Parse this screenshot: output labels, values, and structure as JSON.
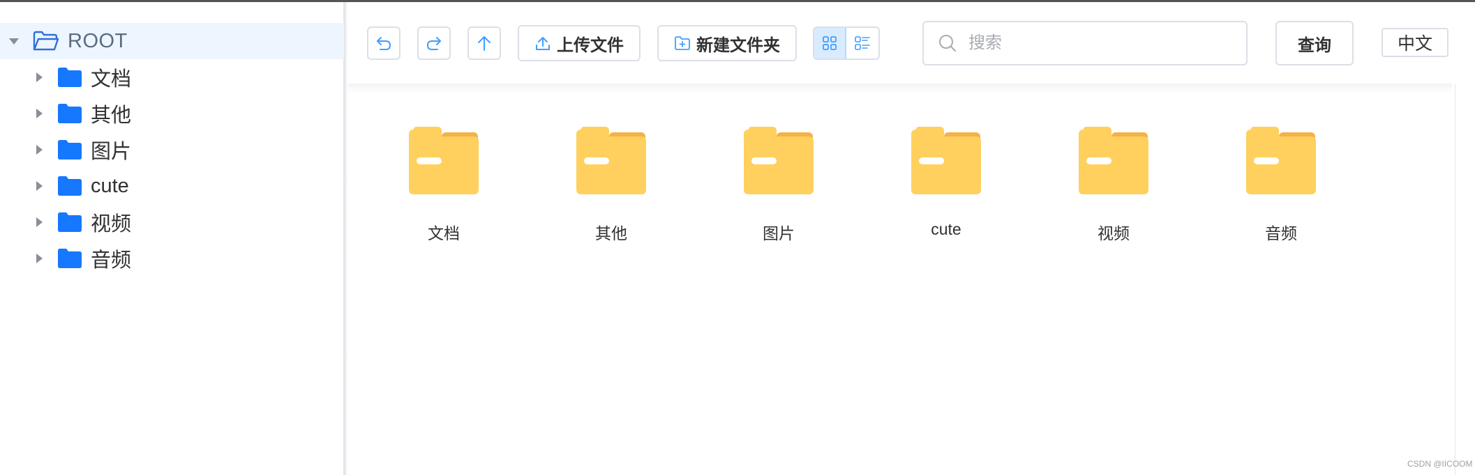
{
  "tree": {
    "root": {
      "label": "ROOT"
    },
    "children": [
      {
        "label": "文档"
      },
      {
        "label": "其他"
      },
      {
        "label": "图片"
      },
      {
        "label": "cute"
      },
      {
        "label": "视频"
      },
      {
        "label": "音频"
      }
    ]
  },
  "toolbar": {
    "back_icon": "undo-icon",
    "forward_icon": "redo-icon",
    "up_icon": "arrow-up-icon",
    "upload_label": "上传文件",
    "new_folder_label": "新建文件夹",
    "search_placeholder": "搜索",
    "query_label": "查询",
    "lang_label": "中文",
    "view_modes": [
      "grid",
      "list"
    ],
    "active_view": "grid"
  },
  "folders": [
    {
      "name": "文档"
    },
    {
      "name": "其他"
    },
    {
      "name": "图片"
    },
    {
      "name": "cute"
    },
    {
      "name": "视频"
    },
    {
      "name": "音频"
    }
  ],
  "colors": {
    "accent": "#409eff",
    "tree_folder": "#1677ff",
    "folder_body": "#ffd05d",
    "folder_tab": "#f5b14a",
    "root_highlight": "#edf5fe"
  },
  "watermark": "CSDN @IICOOM"
}
